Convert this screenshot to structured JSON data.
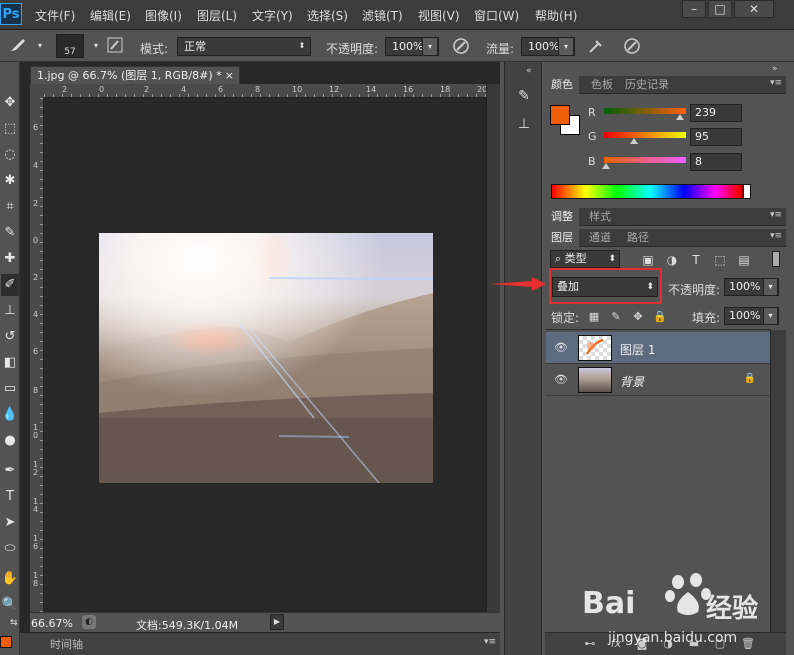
{
  "app": {
    "logo": "Ps"
  },
  "menu": [
    "文件(F)",
    "编辑(E)",
    "图像(I)",
    "图层(L)",
    "文字(Y)",
    "选择(S)",
    "滤镜(T)",
    "视图(V)",
    "窗口(W)",
    "帮助(H)"
  ],
  "window_controls": [
    "–",
    "□",
    "✕"
  ],
  "options": {
    "brush_size": "57",
    "mode_label": "模式:",
    "mode_value": "正常",
    "opacity_label": "不透明度:",
    "opacity_value": "100%",
    "flow_label": "流量:",
    "flow_value": "100%"
  },
  "document": {
    "tab_title": "1.jpg @ 66.7% (图层 1, RGB/8#) *",
    "tab_close": "×",
    "ruler_h": [
      "2",
      "0",
      "2",
      "4",
      "6",
      "8",
      "10",
      "12",
      "14",
      "16",
      "18",
      "20",
      "2"
    ],
    "ruler_v": [
      "6",
      "4",
      "2",
      "0",
      "2",
      "4",
      "6",
      "8",
      "1\n0",
      "1\n2",
      "1\n4",
      "1\n6",
      "1\n8"
    ],
    "zoom": "66.67%",
    "doc_info": "文档:549.3K/1.04M",
    "timeline_label": "时间轴"
  },
  "color_panel": {
    "tabs": [
      "颜色",
      "色板",
      "历史记录"
    ],
    "fg_color": "#ef5f08",
    "bg_color": "#ffffff",
    "r_label": "R",
    "r_value": "239",
    "g_label": "G",
    "g_value": "95",
    "b_label": "B",
    "b_value": "8"
  },
  "adjust_panel": {
    "tabs": [
      "调整",
      "样式"
    ]
  },
  "layers_panel": {
    "tabs": [
      "图层",
      "通道",
      "路径"
    ],
    "filter_kind": "类型",
    "blend_mode": "叠加",
    "opacity_label": "不透明度:",
    "opacity_value": "100%",
    "lock_label": "锁定:",
    "fill_label": "填充:",
    "fill_value": "100%",
    "layers": [
      {
        "name": "图层 1",
        "selected": true
      },
      {
        "name": "背景",
        "locked": true
      }
    ]
  },
  "watermark": {
    "brand": "Bai",
    "brand2": "经验",
    "url": "jingyan.baidu.com"
  }
}
